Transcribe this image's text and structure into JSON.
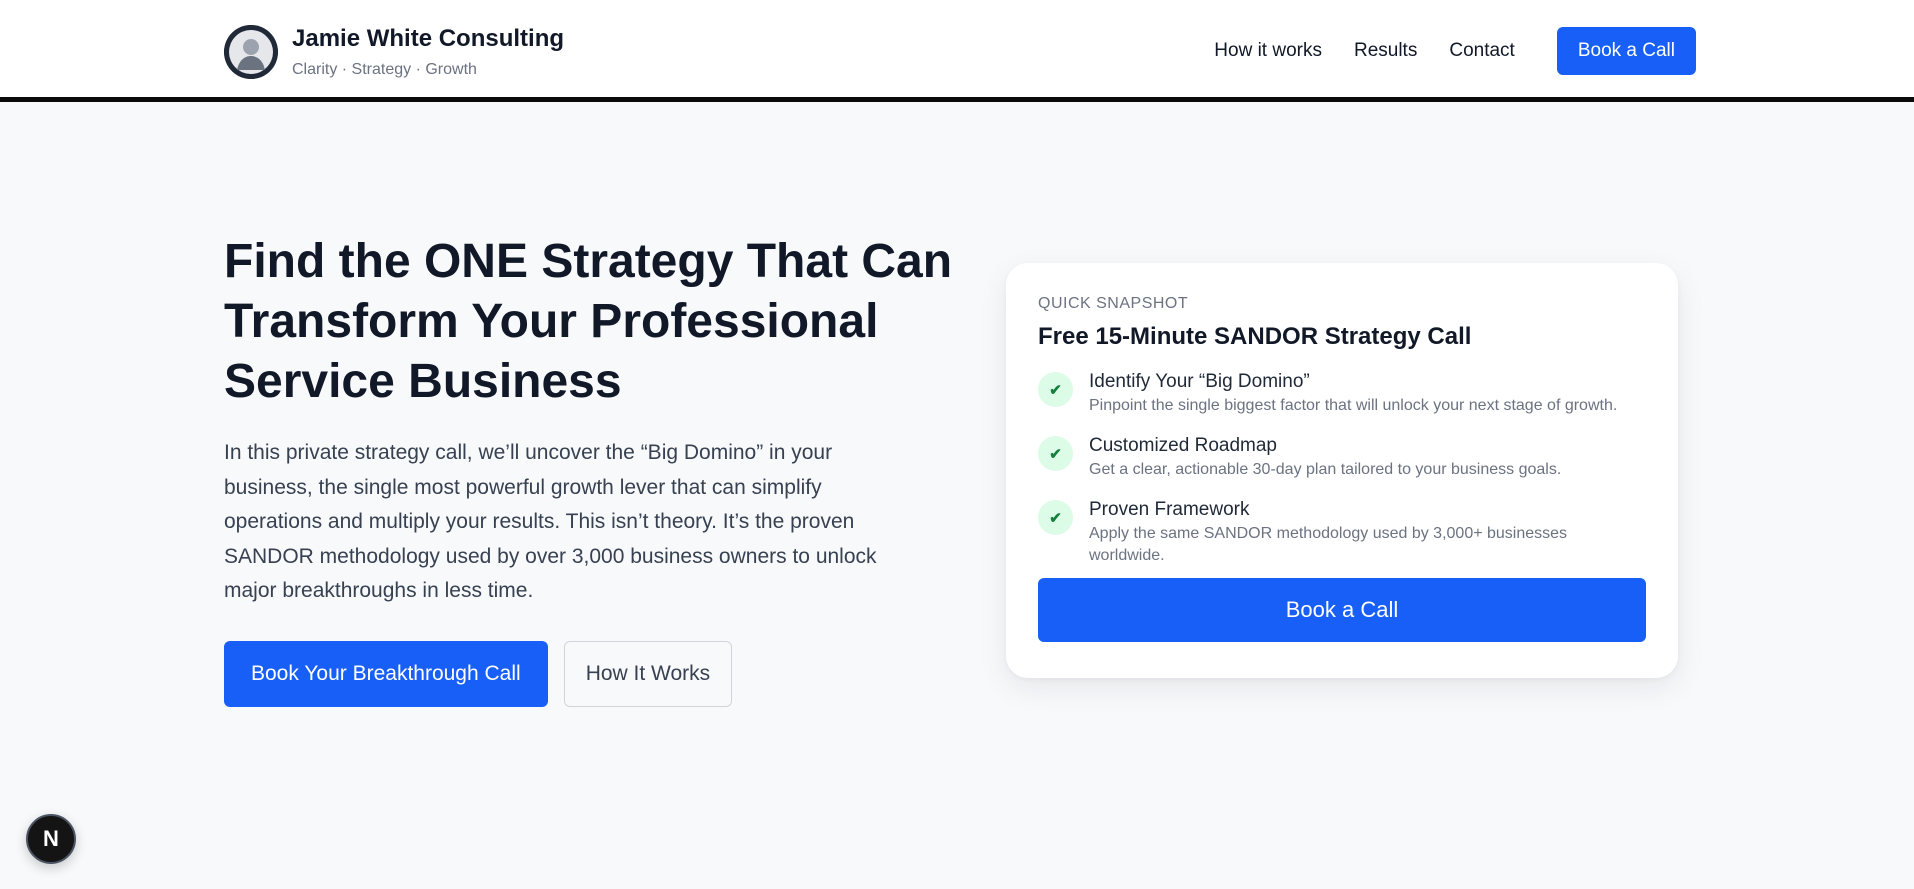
{
  "header": {
    "brand_name": "Jamie White Consulting",
    "brand_tagline": "Clarity · Strategy · Growth",
    "nav": [
      "How it works",
      "Results",
      "Contact"
    ],
    "cta_label": "Book a Call"
  },
  "hero": {
    "title": "Find the ONE Strategy That Can Transform Your Professional Service Business",
    "subtitle": "In this private strategy call, we’ll uncover the “Big Domino” in your business, the single most powerful growth lever that can simplify operations and multiply your results. This isn’t theory. It’s the proven SANDOR methodology used by over 3,000 business owners to unlock major breakthroughs in less time.",
    "primary_cta": "Book Your Breakthrough Call",
    "secondary_cta": "How It Works"
  },
  "card": {
    "eyebrow": "QUICK SNAPSHOT",
    "title": "Free 15-Minute SANDOR Strategy Call",
    "features": [
      {
        "title": "Identify Your “Big Domino”",
        "desc": "Pinpoint the single biggest factor that will unlock your next stage of growth."
      },
      {
        "title": "Customized Roadmap",
        "desc": "Get a clear, actionable 30-day plan tailored to your business goals."
      },
      {
        "title": "Proven Framework",
        "desc": "Apply the same SANDOR methodology used by 3,000+ businesses worldwide."
      }
    ],
    "check_glyph": "✔",
    "cta_label": "Book a Call"
  },
  "fab": {
    "glyph": "N",
    "icon": "nextjs-icon"
  },
  "colors": {
    "accent": "#175ff7",
    "background": "#f8f9fb",
    "check_bg": "#dcfce7",
    "check_fg": "#15803d"
  }
}
